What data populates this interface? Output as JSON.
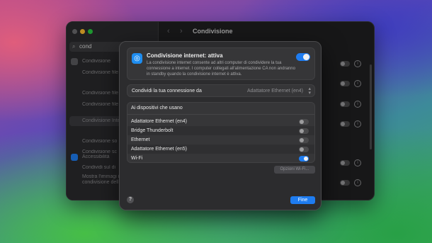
{
  "background_window": {
    "title": "Condivisione",
    "search_value": "cond",
    "sidebar_items": [
      {
        "label": "Condivisione"
      },
      {
        "label": "Condivisione file"
      },
      {
        "label": "Condivisione file"
      },
      {
        "label": "Condivisione file multimediali"
      },
      {
        "label": "Condivisione Inte"
      },
      {
        "label": "Condivisione so"
      },
      {
        "label": "Condivisione sc"
      },
      {
        "label": "Accessibilità"
      },
      {
        "label": "Condividi sul di"
      },
      {
        "label": "Mostra l'immagi ingrandita dura condivisione dell"
      }
    ]
  },
  "sheet": {
    "internet_sharing": {
      "title": "Condivisione internet: attiva",
      "description": "La condivisione internet consente ad altri computer di condividere la tua connessione a internet. I computer collegati all'alimentazione CA non andranno in standby quando la condivisione internet è attiva.",
      "enabled": true
    },
    "share_connection": {
      "label": "Condividi la tua connessione da",
      "value": "Adattatore Ethernet (en4)"
    },
    "devices": {
      "header": "Ai dispositivi che usano",
      "items": [
        {
          "label": "Adattatore Ethernet (en4)",
          "enabled": false
        },
        {
          "label": "Bridge Thunderbolt",
          "enabled": false
        },
        {
          "label": "Ethernet",
          "enabled": false
        },
        {
          "label": "Adattatore Ethernet (en5)",
          "enabled": false
        },
        {
          "label": "Wi-Fi",
          "enabled": true
        }
      ]
    },
    "wifi_options_label": "Opzioni Wi-Fi...",
    "help_label": "?",
    "done_label": "Fine"
  },
  "colors": {
    "accent": "#1e7cf0",
    "sheet_bg": "#2c2c2e",
    "window_bg": "#1f1f21"
  },
  "icons": {
    "search": "magnifier-icon",
    "share": "globe-share-icon",
    "back": "chevron-left-icon",
    "forward": "chevron-right-icon",
    "info": "info-icon",
    "popup": "chevron-updown-icon"
  }
}
